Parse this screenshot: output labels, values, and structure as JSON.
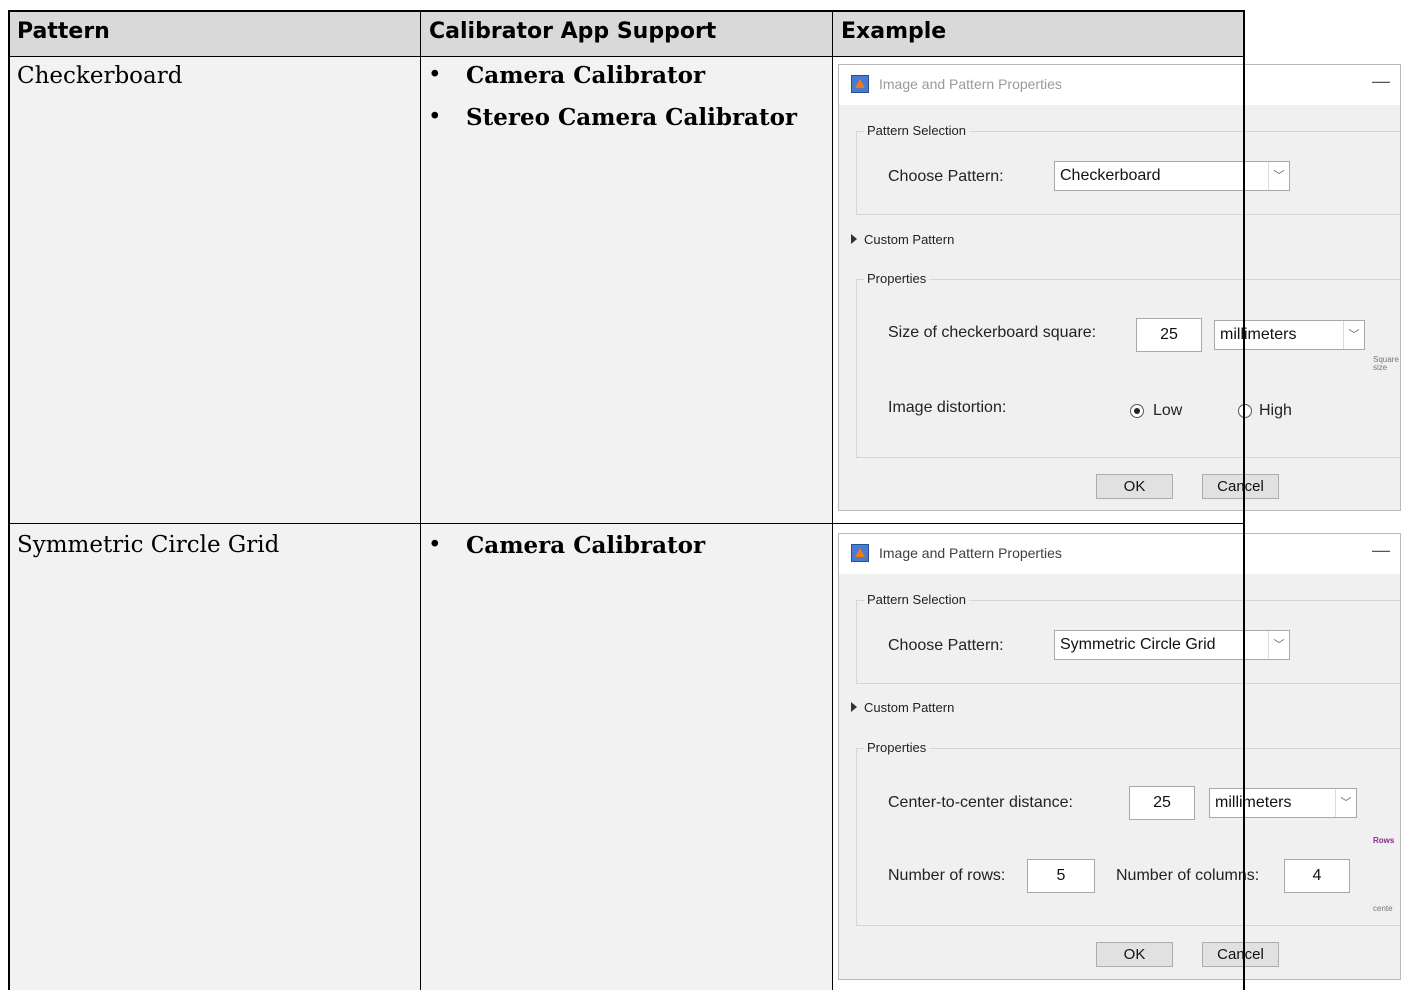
{
  "table": {
    "headers": [
      "Pattern",
      "Calibrator App Support",
      "Example"
    ],
    "rows": [
      {
        "pattern": "Checkerboard",
        "apps": [
          "Camera Calibrator",
          "Stereo Camera Calibrator"
        ]
      },
      {
        "pattern": "Symmetric Circle Grid",
        "apps": [
          "Camera Calibrator"
        ]
      }
    ]
  },
  "dialog1": {
    "title": "Image and Pattern Properties",
    "minimize": "—",
    "pattern_selection_legend": "Pattern Selection",
    "choose_pattern_label": "Choose Pattern:",
    "choose_pattern_value": "Checkerboard",
    "custom_pattern": "Custom Pattern",
    "properties_legend": "Properties",
    "size_label": "Size of checkerboard square:",
    "size_value": "25",
    "units": "millimeters",
    "distortion_label": "Image distortion:",
    "low_label": "Low",
    "high_label": "High",
    "distortion_selected": "Low",
    "ok": "OK",
    "cancel": "Cancel",
    "side_text": "Square\nsize"
  },
  "dialog2": {
    "title": "Image and Pattern Properties",
    "minimize": "—",
    "pattern_selection_legend": "Pattern Selection",
    "choose_pattern_label": "Choose Pattern:",
    "choose_pattern_value": "Symmetric Circle Grid",
    "custom_pattern": "Custom Pattern",
    "properties_legend": "Properties",
    "distance_label": "Center-to-center distance:",
    "distance_value": "25",
    "units": "millimeters",
    "rows_label": "Number of rows:",
    "rows_value": "5",
    "cols_label": "Number of columns:",
    "cols_value": "4",
    "ok": "OK",
    "cancel": "Cancel",
    "side_text_1": "Rows",
    "side_text_2": "cente"
  },
  "colors": {
    "header_bg": "#d9d9d9",
    "cell_bg": "#f2f2f2",
    "dialog_bg": "#f0f0f0",
    "side_accent": "#8a2b8f"
  }
}
